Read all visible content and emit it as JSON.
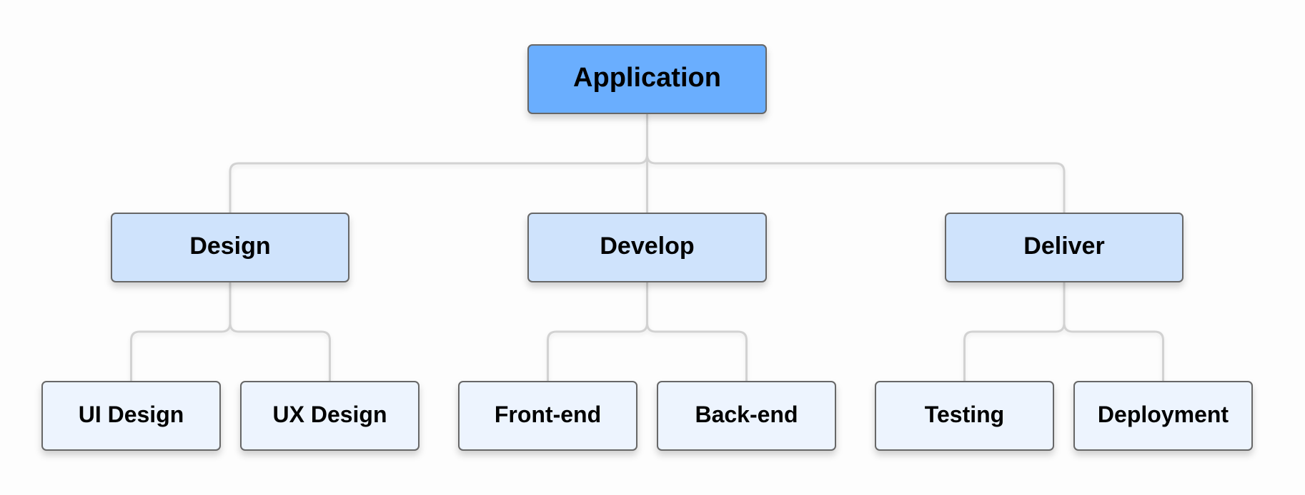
{
  "diagram": {
    "type": "tree",
    "connector_color": "#d2d2d2",
    "border_color": "#676767",
    "root": {
      "id": "application",
      "label": "Application",
      "fill": "#6aaefe",
      "children": [
        {
          "id": "design",
          "label": "Design",
          "fill": "#cfe3fc",
          "children": [
            {
              "id": "ui-design",
              "label": "UI Design",
              "fill": "#edf4fe"
            },
            {
              "id": "ux-design",
              "label": "UX Design",
              "fill": "#edf4fe"
            }
          ]
        },
        {
          "id": "develop",
          "label": "Develop",
          "fill": "#cfe3fc",
          "children": [
            {
              "id": "front-end",
              "label": "Front-end",
              "fill": "#edf4fe"
            },
            {
              "id": "back-end",
              "label": "Back-end",
              "fill": "#edf4fe"
            }
          ]
        },
        {
          "id": "deliver",
          "label": "Deliver",
          "fill": "#cfe3fc",
          "children": [
            {
              "id": "testing",
              "label": "Testing",
              "fill": "#edf4fe"
            },
            {
              "id": "deployment",
              "label": "Deployment",
              "fill": "#edf4fe"
            }
          ]
        }
      ]
    }
  }
}
